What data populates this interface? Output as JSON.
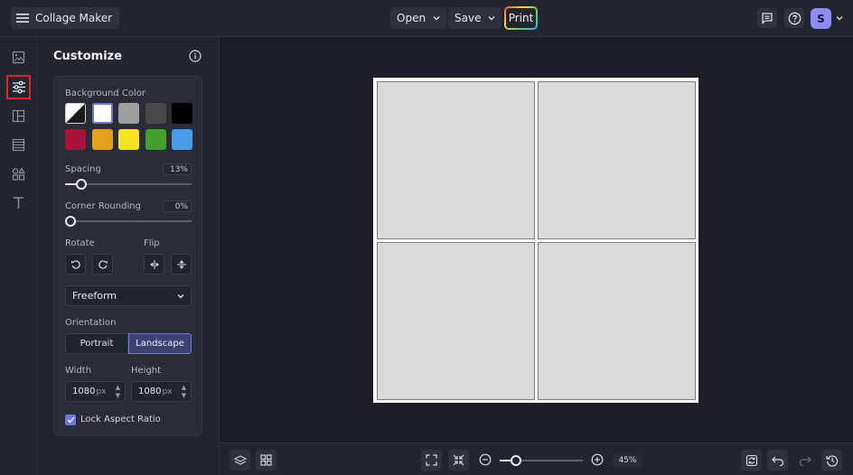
{
  "topbar": {
    "app_title": "Collage Maker",
    "open_label": "Open",
    "save_label": "Save",
    "print_label": "Print",
    "avatar_initial": "S"
  },
  "panel": {
    "title": "Customize",
    "background_color_label": "Background Color",
    "swatches": [
      "transparent",
      "#ffffff",
      "#9e9e9e",
      "#4a4a4a",
      "#000000",
      "#a8123a",
      "#e3a01b",
      "#f5e320",
      "#43a02d",
      "#4a9be8"
    ],
    "spacing_label": "Spacing",
    "spacing_value": "13%",
    "spacing_fraction": 0.13,
    "corner_rounding_label": "Corner Rounding",
    "corner_rounding_value": "0%",
    "corner_rounding_fraction": 0.0,
    "rotate_label": "Rotate",
    "flip_label": "Flip",
    "layout_select": "Freeform",
    "orientation_label": "Orientation",
    "orientation_portrait": "Portrait",
    "orientation_landscape": "Landscape",
    "width_label": "Width",
    "height_label": "Height",
    "width_value": "1080",
    "height_value": "1080",
    "unit": "px",
    "lock_aspect_label": "Lock Aspect Ratio"
  },
  "rail": [
    "image-icon",
    "sliders-icon",
    "layout-icon",
    "texture-icon",
    "shapes-icon",
    "text-icon"
  ],
  "bottombar": {
    "zoom_value": "45%",
    "zoom_fraction": 0.2
  },
  "colors": {
    "accent": "#6b73e8",
    "active_rail_border": "#e0242f"
  }
}
